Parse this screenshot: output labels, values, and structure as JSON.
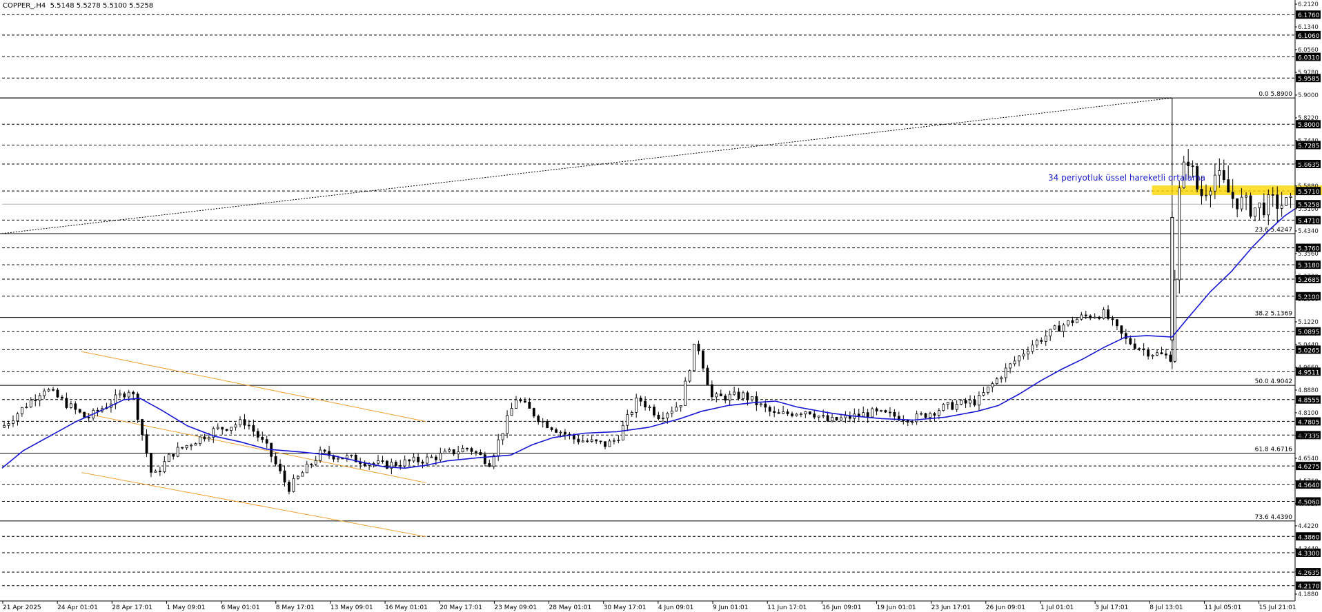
{
  "header": {
    "symbol": "COPPER_,H4",
    "ohlc": "5.5148 5.5278 5.5100 5.5258"
  },
  "annotation_text": "34 periyotluk üssel hareketli ortalama",
  "colors": {
    "candle": "#000000",
    "ema": "#1515d6",
    "channel": "#f0a030",
    "zone": "#ffd700",
    "annotation": "#1a1ad0",
    "grid": "#000000",
    "label_bg": "#000000",
    "label_fg": "#ffffff"
  },
  "chart_data": {
    "type": "candlestick",
    "symbol": "COPPER_",
    "timeframe": "H4",
    "ylim": [
      4.188,
      6.212
    ],
    "x_ticks": [
      "21 Apr 2025",
      "24 Apr 01:01",
      "28 Apr 17:01",
      "1 May 09:01",
      "6 May 01:01",
      "8 May 17:01",
      "13 May 09:01",
      "16 May 01:01",
      "20 May 17:01",
      "23 May 09:01",
      "28 May 01:01",
      "30 May 17:01",
      "4 Jun 09:01",
      "9 Jun 01:01",
      "11 Jun 17:01",
      "16 Jun 09:01",
      "19 Jun 01:01",
      "23 Jun 17:01",
      "26 Jun 09:01",
      "1 Jul 01:01",
      "3 Jul 17:01",
      "8 Jul 13:01",
      "11 Jul 05:01",
      "15 Jul 21:01"
    ],
    "y_ticks": [
      "6.2120",
      "6.1340",
      "6.0560",
      "5.9780",
      "5.9000",
      "5.8220",
      "5.7440",
      "5.6660",
      "5.5880",
      "5.5100",
      "5.4340",
      "5.3560",
      "5.2780",
      "5.2000",
      "5.1220",
      "5.0440",
      "4.9660",
      "4.8880",
      "4.8100",
      "4.7320",
      "4.6540",
      "4.5760",
      "4.4980",
      "4.4220",
      "4.3440",
      "4.2660",
      "4.1880"
    ],
    "level_labels": [
      "6.1760",
      "6.1060",
      "6.0310",
      "5.9585",
      "5.8000",
      "5.7285",
      "5.6635",
      "5.5710",
      "5.5258",
      "5.4710",
      "5.3760",
      "5.3180",
      "5.2685",
      "5.2100",
      "5.0895",
      "5.0265",
      "4.9511",
      "4.8555",
      "4.7805",
      "4.7335",
      "4.6275",
      "4.5640",
      "4.5060",
      "4.3860",
      "4.3300",
      "4.2635",
      "4.2170"
    ],
    "current_price": "5.5258",
    "fibonacci": [
      {
        "label": "0.0 5.8900",
        "value": 5.89
      },
      {
        "label": "23.6 5.4247",
        "value": 5.4247
      },
      {
        "label": "38.2 5.1369",
        "value": 5.1369
      },
      {
        "label": "50.0 4.9042",
        "value": 4.9042
      },
      {
        "label": "61.8 4.6716",
        "value": 4.6716
      },
      {
        "label": "73.6 4.4390",
        "value": 4.439
      }
    ],
    "resistance_zone": [
      5.557,
      5.59
    ],
    "trend_line": [
      [
        0,
        5.425
      ],
      [
        1104,
        5.89
      ]
    ],
    "ema_period": 34,
    "ema_points": [
      [
        0,
        4.62
      ],
      [
        20,
        4.68
      ],
      [
        45,
        4.73
      ],
      [
        70,
        4.78
      ],
      [
        95,
        4.82
      ],
      [
        115,
        4.855
      ],
      [
        130,
        4.86
      ],
      [
        150,
        4.82
      ],
      [
        175,
        4.765
      ],
      [
        200,
        4.73
      ],
      [
        225,
        4.71
      ],
      [
        250,
        4.685
      ],
      [
        280,
        4.676
      ],
      [
        310,
        4.665
      ],
      [
        340,
        4.64
      ],
      [
        360,
        4.625
      ],
      [
        380,
        4.62
      ],
      [
        400,
        4.63
      ],
      [
        420,
        4.645
      ],
      [
        450,
        4.656
      ],
      [
        480,
        4.665
      ],
      [
        500,
        4.7
      ],
      [
        520,
        4.725
      ],
      [
        550,
        4.74
      ],
      [
        580,
        4.745
      ],
      [
        610,
        4.76
      ],
      [
        640,
        4.79
      ],
      [
        660,
        4.815
      ],
      [
        685,
        4.835
      ],
      [
        710,
        4.845
      ],
      [
        730,
        4.85
      ],
      [
        750,
        4.83
      ],
      [
        780,
        4.81
      ],
      [
        800,
        4.8
      ],
      [
        830,
        4.79
      ],
      [
        860,
        4.785
      ],
      [
        890,
        4.795
      ],
      [
        920,
        4.815
      ],
      [
        940,
        4.835
      ],
      [
        960,
        4.875
      ],
      [
        980,
        4.92
      ],
      [
        1000,
        4.96
      ],
      [
        1020,
        4.995
      ],
      [
        1040,
        5.035
      ],
      [
        1060,
        5.07
      ],
      [
        1080,
        5.075
      ],
      [
        1104,
        5.07
      ],
      [
        1120,
        5.14
      ],
      [
        1140,
        5.225
      ],
      [
        1160,
        5.295
      ],
      [
        1180,
        5.38
      ],
      [
        1195,
        5.435
      ],
      [
        1210,
        5.485
      ],
      [
        1220,
        5.51
      ]
    ],
    "candles_env": [
      [
        0,
        4.76
      ],
      [
        40,
        4.895
      ],
      [
        80,
        4.79
      ],
      [
        122,
        4.895
      ],
      [
        142,
        4.585
      ],
      [
        160,
        4.67
      ],
      [
        200,
        4.75
      ],
      [
        230,
        4.78
      ],
      [
        250,
        4.69
      ],
      [
        270,
        4.55
      ],
      [
        300,
        4.67
      ],
      [
        320,
        4.66
      ],
      [
        360,
        4.63
      ],
      [
        400,
        4.65
      ],
      [
        440,
        4.69
      ],
      [
        460,
        4.64
      ],
      [
        485,
        4.86
      ],
      [
        510,
        4.78
      ],
      [
        540,
        4.72
      ],
      [
        570,
        4.7
      ],
      [
        580,
        4.72
      ],
      [
        600,
        4.86
      ],
      [
        620,
        4.8
      ],
      [
        640,
        4.84
      ],
      [
        655,
        5.06
      ],
      [
        670,
        4.86
      ],
      [
        700,
        4.87
      ],
      [
        730,
        4.8
      ],
      [
        760,
        4.82
      ],
      [
        780,
        4.78
      ],
      [
        820,
        4.81
      ],
      [
        860,
        4.79
      ],
      [
        890,
        4.83
      ],
      [
        920,
        4.85
      ],
      [
        945,
        4.95
      ],
      [
        970,
        5.04
      ],
      [
        1000,
        5.11
      ],
      [
        1020,
        5.14
      ],
      [
        1040,
        5.15
      ],
      [
        1060,
        5.06
      ],
      [
        1080,
        5.02
      ],
      [
        1103,
        5.0
      ],
      [
        1110,
        5.55
      ],
      [
        1118,
        5.7
      ],
      [
        1130,
        5.55
      ],
      [
        1145,
        5.63
      ],
      [
        1160,
        5.55
      ],
      [
        1180,
        5.51
      ],
      [
        1200,
        5.53
      ],
      [
        1220,
        5.52
      ]
    ],
    "channel_lines": [
      [
        [
          75,
          5.02
        ],
        [
          400,
          4.78
        ]
      ],
      [
        [
          75,
          4.81
        ],
        [
          400,
          4.57
        ]
      ],
      [
        [
          75,
          4.605
        ],
        [
          400,
          4.385
        ]
      ]
    ]
  }
}
